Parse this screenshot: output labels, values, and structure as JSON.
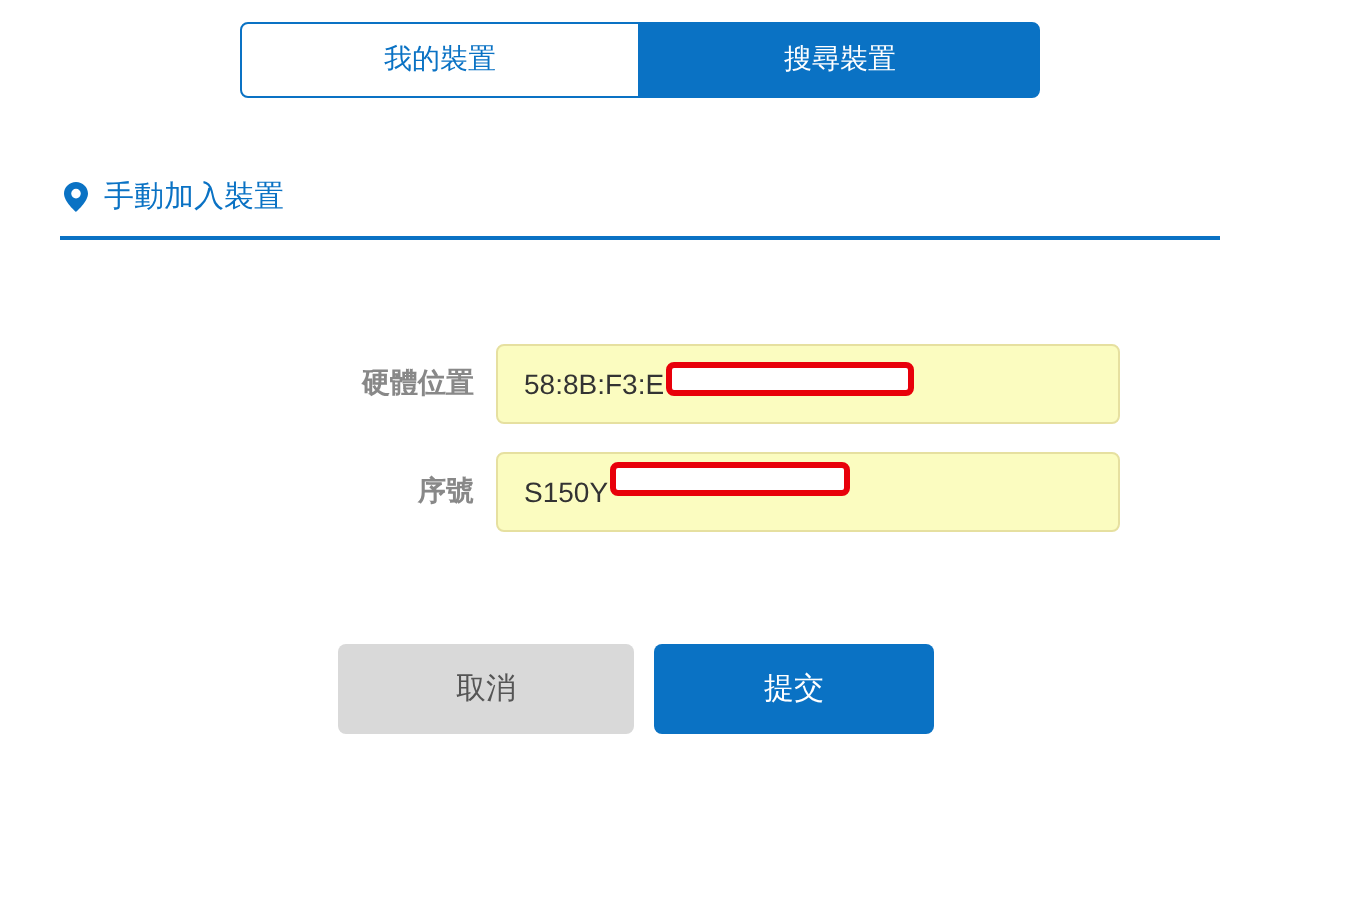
{
  "tabs": [
    {
      "label": "我的裝置",
      "selected": false
    },
    {
      "label": "搜尋裝置",
      "selected": true
    }
  ],
  "section": {
    "title": "手動加入裝置"
  },
  "fields": [
    {
      "label": "硬體位置",
      "value": "58:8B:F3:E",
      "redacted": true
    },
    {
      "label": "序號",
      "value": "S150Y",
      "redacted": true
    }
  ],
  "buttons": [
    {
      "label": "取消",
      "kind": "secondary"
    },
    {
      "label": "提交",
      "kind": "primary"
    }
  ]
}
